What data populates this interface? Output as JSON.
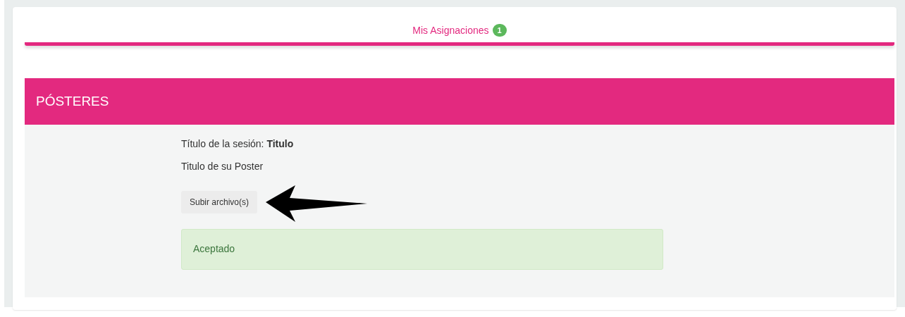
{
  "tabs": [
    {
      "label": "Mis Asignaciones",
      "badge": "1",
      "selected": true
    }
  ],
  "panel": {
    "title": "PÓSTERES",
    "session_title": "Título de la sesión: **Titulo**",
    "poster_title": "Titulo de su Poster",
    "upload_button": "Subir archivo(s)",
    "alert": {
      "kind": "success",
      "text": "Aceptado"
    }
  }
}
